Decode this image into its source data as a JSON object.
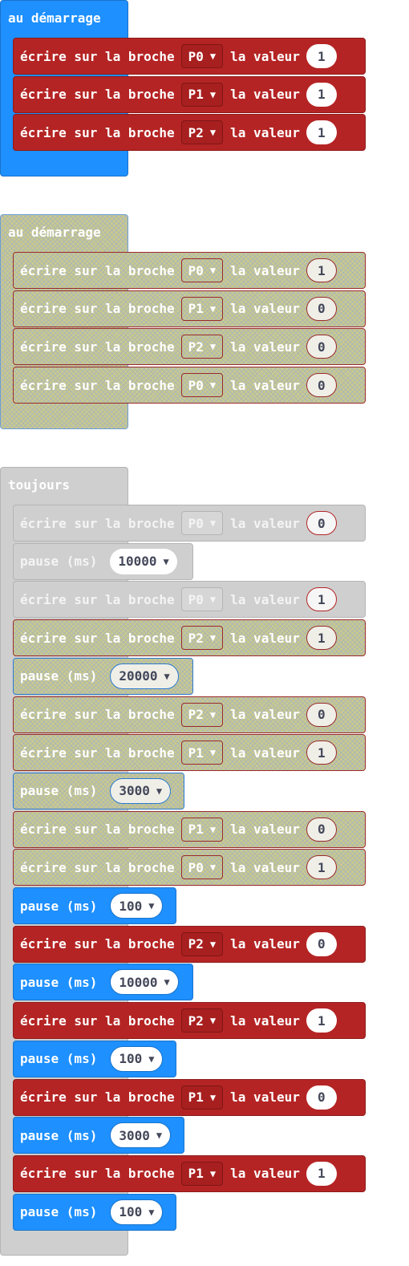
{
  "groups": [
    {
      "title": "au démarrage",
      "style": "blue",
      "blocks": [
        {
          "kind": "write",
          "label": "écrire sur la broche",
          "pin": "P0",
          "value_label": "la valeur",
          "value": "1",
          "style": "red"
        },
        {
          "kind": "write",
          "label": "écrire sur la broche",
          "pin": "P1",
          "value_label": "la valeur",
          "value": "1",
          "style": "red"
        },
        {
          "kind": "write",
          "label": "écrire sur la broche",
          "pin": "P2",
          "value_label": "la valeur",
          "value": "1",
          "style": "red"
        }
      ]
    },
    {
      "title": "au démarrage",
      "style": "disabled",
      "blocks": [
        {
          "kind": "write",
          "label": "écrire sur la broche",
          "pin": "P0",
          "value_label": "la valeur",
          "value": "1",
          "style": "disabled-red"
        },
        {
          "kind": "write",
          "label": "écrire sur la broche",
          "pin": "P1",
          "value_label": "la valeur",
          "value": "0",
          "style": "disabled-red"
        },
        {
          "kind": "write",
          "label": "écrire sur la broche",
          "pin": "P2",
          "value_label": "la valeur",
          "value": "0",
          "style": "disabled-red"
        },
        {
          "kind": "write",
          "label": "écrire sur la broche",
          "pin": "P0",
          "value_label": "la valeur",
          "value": "0",
          "style": "disabled-red"
        }
      ]
    },
    {
      "title": "toujours",
      "style": "grey",
      "blocks": [
        {
          "kind": "write",
          "label": "écrire sur la broche",
          "pin": "P0",
          "value_label": "la valeur",
          "value": "0",
          "style": "grey"
        },
        {
          "kind": "pause",
          "label": "pause (ms)",
          "value": "10000",
          "style": "grey"
        },
        {
          "kind": "write",
          "label": "écrire sur la broche",
          "pin": "P0",
          "value_label": "la valeur",
          "value": "1",
          "style": "grey"
        },
        {
          "kind": "write",
          "label": "écrire sur la broche",
          "pin": "P2",
          "value_label": "la valeur",
          "value": "1",
          "style": "disabled-red"
        },
        {
          "kind": "pause",
          "label": "pause (ms)",
          "value": "20000",
          "style": "disabled-blue"
        },
        {
          "kind": "write",
          "label": "écrire sur la broche",
          "pin": "P2",
          "value_label": "la valeur",
          "value": "0",
          "style": "disabled-red"
        },
        {
          "kind": "write",
          "label": "écrire sur la broche",
          "pin": "P1",
          "value_label": "la valeur",
          "value": "1",
          "style": "disabled-red"
        },
        {
          "kind": "pause",
          "label": "pause (ms)",
          "value": "3000",
          "style": "disabled-blue"
        },
        {
          "kind": "write",
          "label": "écrire sur la broche",
          "pin": "P1",
          "value_label": "la valeur",
          "value": "0",
          "style": "disabled-red"
        },
        {
          "kind": "write",
          "label": "écrire sur la broche",
          "pin": "P0",
          "value_label": "la valeur",
          "value": "1",
          "style": "disabled-red"
        },
        {
          "kind": "pause",
          "label": "pause (ms)",
          "value": "100",
          "style": "blue"
        },
        {
          "kind": "write",
          "label": "écrire sur la broche",
          "pin": "P2",
          "value_label": "la valeur",
          "value": "0",
          "style": "red"
        },
        {
          "kind": "pause",
          "label": "pause (ms)",
          "value": "10000",
          "style": "blue"
        },
        {
          "kind": "write",
          "label": "écrire sur la broche",
          "pin": "P2",
          "value_label": "la valeur",
          "value": "1",
          "style": "red"
        },
        {
          "kind": "pause",
          "label": "pause (ms)",
          "value": "100",
          "style": "blue"
        },
        {
          "kind": "write",
          "label": "écrire sur la broche",
          "pin": "P1",
          "value_label": "la valeur",
          "value": "0",
          "style": "red"
        },
        {
          "kind": "pause",
          "label": "pause (ms)",
          "value": "3000",
          "style": "blue"
        },
        {
          "kind": "write",
          "label": "écrire sur la broche",
          "pin": "P1",
          "value_label": "la valeur",
          "value": "1",
          "style": "red"
        },
        {
          "kind": "pause",
          "label": "pause (ms)",
          "value": "100",
          "style": "blue"
        }
      ]
    }
  ],
  "colors": {
    "pin_write": "#b52424",
    "pause": "#1e90ff",
    "forever": "#cfcfcf",
    "disabled": "#c9c98d"
  },
  "icons": {
    "dropdown": "caret-down-icon"
  }
}
